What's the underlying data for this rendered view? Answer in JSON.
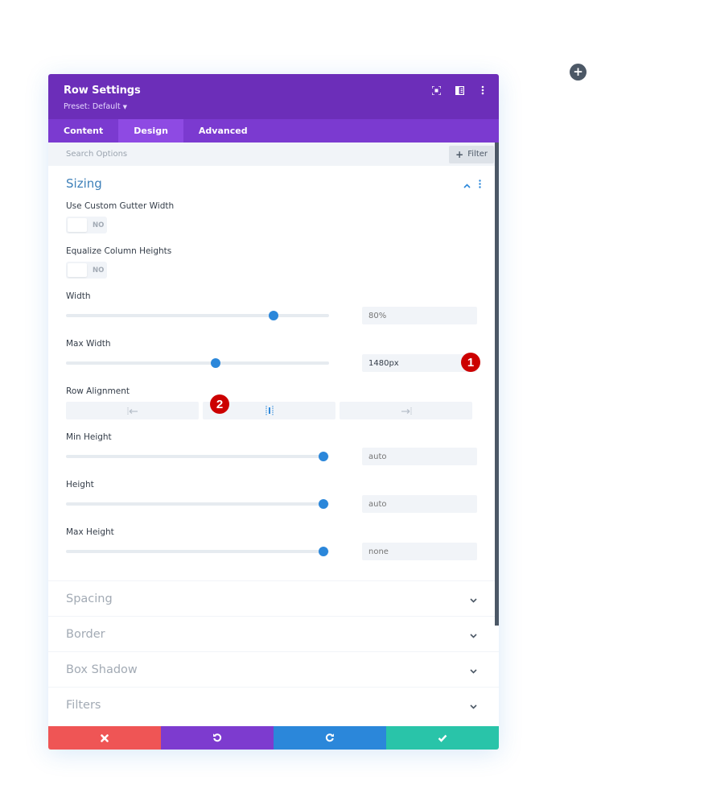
{
  "page": {
    "add_button_icon": "plus-icon"
  },
  "modal": {
    "title": "Row Settings",
    "preset_label": "Preset: Default",
    "header_icons": [
      "fullscreen-icon",
      "split-view-icon",
      "more-options-icon"
    ],
    "tabs": [
      {
        "label": "Content",
        "active": false
      },
      {
        "label": "Design",
        "active": true
      },
      {
        "label": "Advanced",
        "active": false
      }
    ],
    "search": {
      "placeholder": "Search Options",
      "value": ""
    },
    "filter_button": {
      "label": "Filter",
      "icon": "plus-icon"
    },
    "sizing": {
      "title": "Sizing",
      "expanded": true,
      "use_custom_gutter_width": {
        "label": "Use Custom Gutter Width",
        "value": "NO"
      },
      "equalize_column_heights": {
        "label": "Equalize Column Heights",
        "value": "NO"
      },
      "width": {
        "label": "Width",
        "value": "",
        "placeholder": "80%",
        "slider_fraction": 0.79
      },
      "max_width": {
        "label": "Max Width",
        "value": "1480px",
        "placeholder": "",
        "slider_fraction": 0.57,
        "badge": "1"
      },
      "row_alignment": {
        "label": "Row Alignment",
        "options": [
          "align-left-icon",
          "align-center-icon",
          "align-right-icon"
        ],
        "selected": 1,
        "badge": "2"
      },
      "min_height": {
        "label": "Min Height",
        "value": "",
        "placeholder": "auto",
        "slider_fraction": 0.98
      },
      "height": {
        "label": "Height",
        "value": "",
        "placeholder": "auto",
        "slider_fraction": 0.98
      },
      "max_height": {
        "label": "Max Height",
        "value": "",
        "placeholder": "none",
        "slider_fraction": 0.98
      }
    },
    "collapsed_sections": [
      {
        "title": "Spacing"
      },
      {
        "title": "Border"
      },
      {
        "title": "Box Shadow"
      },
      {
        "title": "Filters"
      }
    ],
    "footer": {
      "buttons": [
        {
          "name": "discard",
          "icon": "close-icon",
          "color": "#ef5555"
        },
        {
          "name": "undo",
          "icon": "undo-icon",
          "color": "#7d3bcf"
        },
        {
          "name": "redo",
          "icon": "redo-icon",
          "color": "#2b87da"
        },
        {
          "name": "save",
          "icon": "check-icon",
          "color": "#29c4a9"
        }
      ]
    }
  },
  "colors": {
    "header": "#6c2eb9",
    "tabs": "#7b3ad0",
    "active_tab": "#8e4ae3",
    "accent": "#2b87da",
    "badge": "#cc0000"
  }
}
